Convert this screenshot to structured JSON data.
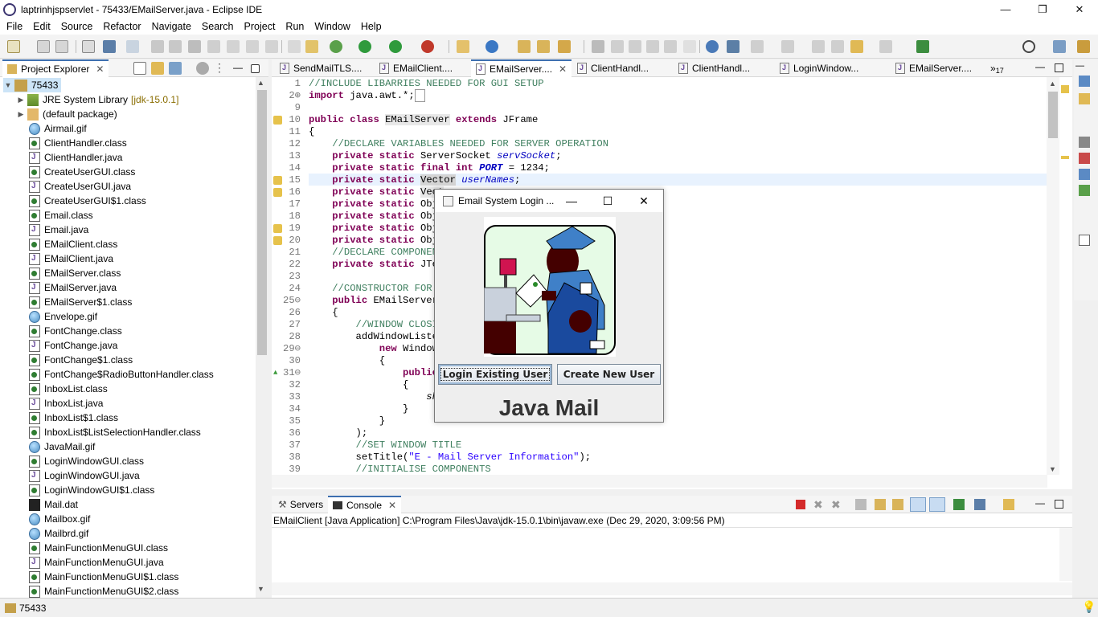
{
  "window": {
    "title": "laptrinhjspservlet - 75433/EMailServer.java - Eclipse IDE",
    "minimize": "—",
    "restore": "❐",
    "close": "✕"
  },
  "menu": [
    "File",
    "Edit",
    "Source",
    "Refactor",
    "Navigate",
    "Search",
    "Project",
    "Run",
    "Window",
    "Help"
  ],
  "project_explorer": {
    "tab": "Project Explorer",
    "project": "75433",
    "jre": "JRE System Library",
    "jre_version": "[jdk-15.0.1]",
    "default_package": "(default package)",
    "files": [
      {
        "name": "Airmail.gif",
        "type": "gif"
      },
      {
        "name": "ClientHandler.class",
        "type": "cls"
      },
      {
        "name": "ClientHandler.java",
        "type": "java"
      },
      {
        "name": "CreateUserGUI.class",
        "type": "cls"
      },
      {
        "name": "CreateUserGUI.java",
        "type": "java"
      },
      {
        "name": "CreateUserGUI$1.class",
        "type": "cls"
      },
      {
        "name": "Email.class",
        "type": "cls"
      },
      {
        "name": "Email.java",
        "type": "java"
      },
      {
        "name": "EMailClient.class",
        "type": "cls"
      },
      {
        "name": "EMailClient.java",
        "type": "java"
      },
      {
        "name": "EMailServer.class",
        "type": "cls"
      },
      {
        "name": "EMailServer.java",
        "type": "java"
      },
      {
        "name": "EMailServer$1.class",
        "type": "cls"
      },
      {
        "name": "Envelope.gif",
        "type": "gif"
      },
      {
        "name": "FontChange.class",
        "type": "cls"
      },
      {
        "name": "FontChange.java",
        "type": "java"
      },
      {
        "name": "FontChange$1.class",
        "type": "cls"
      },
      {
        "name": "FontChange$RadioButtonHandler.class",
        "type": "cls"
      },
      {
        "name": "InboxList.class",
        "type": "cls"
      },
      {
        "name": "InboxList.java",
        "type": "java"
      },
      {
        "name": "InboxList$1.class",
        "type": "cls"
      },
      {
        "name": "InboxList$ListSelectionHandler.class",
        "type": "cls"
      },
      {
        "name": "JavaMail.gif",
        "type": "gif"
      },
      {
        "name": "LoginWindowGUI.class",
        "type": "cls"
      },
      {
        "name": "LoginWindowGUI.java",
        "type": "java"
      },
      {
        "name": "LoginWindowGUI$1.class",
        "type": "cls"
      },
      {
        "name": "Mail.dat",
        "type": "dat"
      },
      {
        "name": "Mailbox.gif",
        "type": "gif"
      },
      {
        "name": "Mailbrd.gif",
        "type": "gif"
      },
      {
        "name": "MainFunctionMenuGUI.class",
        "type": "cls"
      },
      {
        "name": "MainFunctionMenuGUI.java",
        "type": "java"
      },
      {
        "name": "MainFunctionMenuGUI$1.class",
        "type": "cls"
      },
      {
        "name": "MainFunctionMenuGUI$2.class",
        "type": "cls"
      }
    ]
  },
  "editor": {
    "tabs": [
      "SendMailTLS....",
      "EMailClient....",
      "EMailServer....",
      "ClientHandl...",
      "ClientHandl...",
      "LoginWindow...",
      "EMailServer...."
    ],
    "overflow": "»",
    "overflow_count": "17",
    "line_numbers": [
      "1",
      "2⊕",
      "9",
      "10",
      "11",
      "12",
      "13",
      "14",
      "15",
      "16",
      "17",
      "18",
      "19",
      "20",
      "21",
      "22",
      "23",
      "24",
      "25⊖",
      "26",
      "27",
      "28",
      "29⊖",
      "30",
      "31⊖",
      "32",
      "33",
      "34",
      "35",
      "36",
      "37",
      "38",
      "39"
    ]
  },
  "console": {
    "tabs": [
      "Servers",
      "Console"
    ],
    "description": "EMailClient [Java Application] C:\\Program Files\\Java\\jdk-15.0.1\\bin\\javaw.exe  (Dec 29, 2020, 3:09:56 PM)"
  },
  "status": {
    "selection": "75433"
  },
  "dialog": {
    "title": "Email System Login ...",
    "login_button": "Login Existing User",
    "create_button": "Create New User",
    "brand": "Java Mail",
    "min": "—",
    "max": "☐",
    "close": "✕"
  }
}
